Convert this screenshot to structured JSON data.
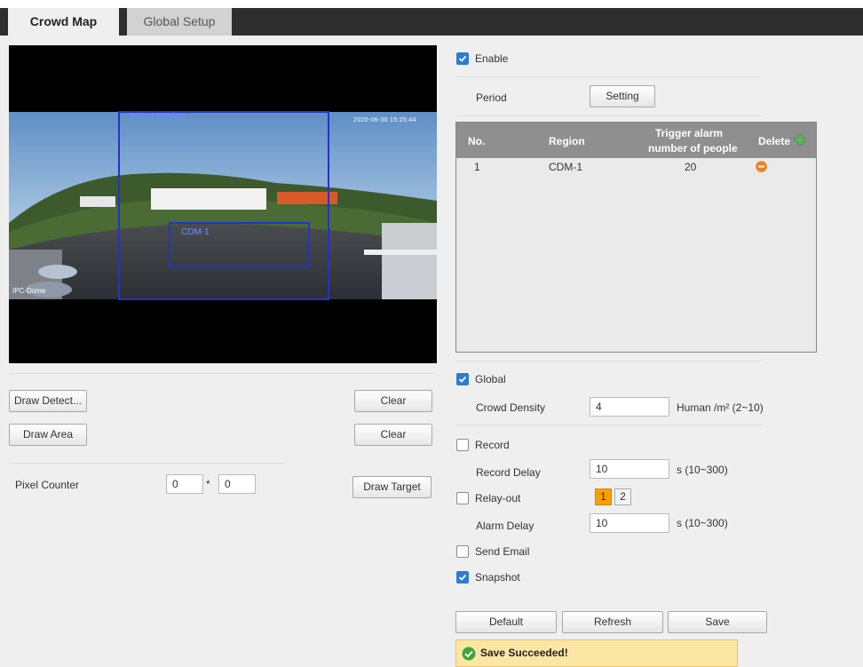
{
  "tabs": [
    {
      "label": "Crowd Map",
      "active": true
    },
    {
      "label": "Global Setup",
      "active": false
    }
  ],
  "video": {
    "detect_region_label": "Detect Region",
    "area_label": "CDM-1",
    "timestamp": "2020-06-30 15:25:44",
    "camera_label": "IPC-Dome"
  },
  "left_panel": {
    "draw_detect_label": "Draw Detect...",
    "clear_label_1": "Clear",
    "draw_area_label": "Draw Area",
    "clear_label_2": "Clear",
    "pixel_counter_label": "Pixel Counter",
    "pixel_w": "0",
    "pixel_sep": "*",
    "pixel_h": "0",
    "draw_target_label": "Draw Target"
  },
  "right_panel": {
    "enable": {
      "label": "Enable",
      "checked": true
    },
    "period_label": "Period",
    "setting_label": "Setting",
    "table": {
      "headers": {
        "no": "No.",
        "region": "Region",
        "trigger_line1": "Trigger alarm",
        "trigger_line2": "number of people",
        "delete": "Delete"
      },
      "rows": [
        {
          "no": "1",
          "region": "CDM-1",
          "trigger": "20"
        }
      ]
    },
    "global": {
      "label": "Global",
      "checked": true
    },
    "crowd_density_label": "Crowd Density",
    "crowd_density_value": "4",
    "crowd_density_unit": "Human /m² (2~10)",
    "record": {
      "label": "Record",
      "checked": false
    },
    "record_delay_label": "Record Delay",
    "record_delay_value": "10",
    "record_delay_unit": "s (10~300)",
    "relay_out": {
      "label": "Relay-out",
      "checked": false
    },
    "relay_channels": [
      "1",
      "2"
    ],
    "alarm_delay_label": "Alarm Delay",
    "alarm_delay_value": "10",
    "alarm_delay_unit": "s (10~300)",
    "send_email": {
      "label": "Send Email",
      "checked": false
    },
    "snapshot": {
      "label": "Snapshot",
      "checked": true
    },
    "default_label": "Default",
    "refresh_label": "Refresh",
    "save_label": "Save",
    "status_message": "Save Succeeded!"
  },
  "colors": {
    "accent": "#2b7cd3",
    "relay_active": "#f4a100",
    "delete_icon": "#f0801c",
    "add_icon": "#5cb85c",
    "toast_bg": "#fbe6a4",
    "region_outline": "#2233cc"
  }
}
